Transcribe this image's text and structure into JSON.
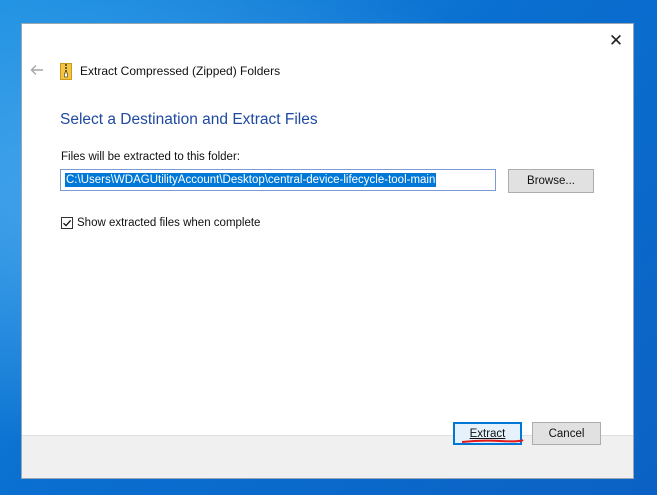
{
  "window": {
    "title": "Extract Compressed (Zipped) Folders",
    "close_glyph": "✕",
    "back_icon": "arrow-left-icon",
    "folder_icon": "zip-folder-icon"
  },
  "main": {
    "heading": "Select a Destination and Extract Files",
    "destination_label": "Files will be extracted to this folder:",
    "destination_path": "C:\\Users\\WDAGUtilityAccount\\Desktop\\central-device-lifecycle-tool-main",
    "browse_label": "Browse...",
    "show_files_label": "Show extracted files when complete",
    "show_files_checked": true
  },
  "footer": {
    "extract_label": "Extract",
    "cancel_label": "Cancel"
  },
  "colors": {
    "heading": "#1f4aa0",
    "selection": "#0078d7",
    "annotation": "#e21b1b"
  }
}
